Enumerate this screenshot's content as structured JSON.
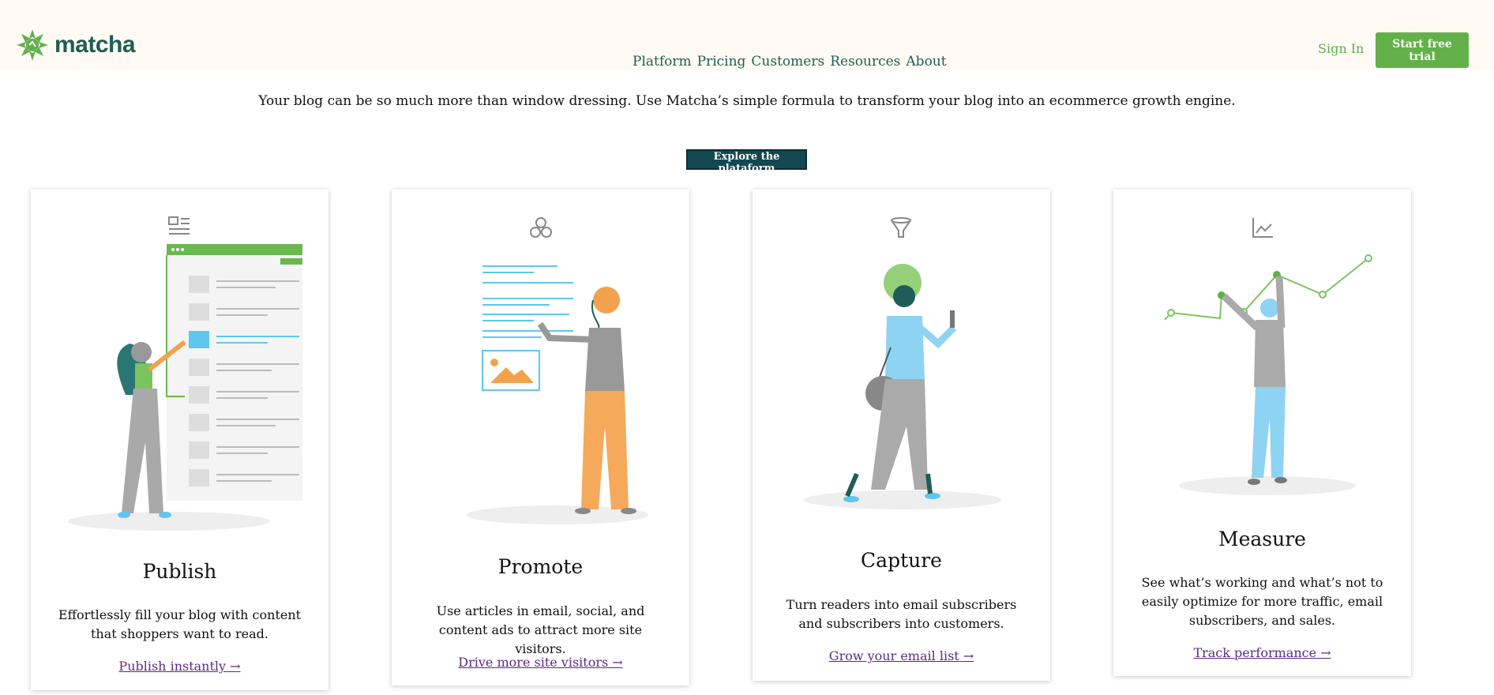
{
  "header": {
    "logo_text": "matcha",
    "nav": [
      "Platform",
      "Pricing",
      "Customers",
      "Resources",
      "About"
    ],
    "sign_in": "Sign In",
    "cta": "Start free trial"
  },
  "hero": {
    "tagline": "Your blog can be so much more than window dressing. Use Matcha’s simple formula to transform your blog into an ecommerce growth engine.",
    "button": "Explore the plataform"
  },
  "cards": [
    {
      "icon": "article-icon",
      "title": "Publish",
      "desc": "Effortlessly fill your blog with content that shoppers want to read.",
      "link": "Publish instantly →"
    },
    {
      "icon": "share-icon",
      "title": "Promote",
      "desc": "Use articles in email, social, and content ads to attract more site visitors.",
      "link": "Drive more site visitors →"
    },
    {
      "icon": "funnel-icon",
      "title": "Capture",
      "desc": "Turn readers into email subscribers and subscribers into customers.",
      "link": "Grow your email list →"
    },
    {
      "icon": "chart-icon",
      "title": "Measure",
      "desc": "See what’s working and what’s not to easily optimize for more traffic, email subscribers, and sales.",
      "link": "Track performance →"
    }
  ],
  "colors": {
    "brand_green": "#62b148",
    "brand_teal": "#1f5d56",
    "link_purple": "#5b2a86",
    "header_bg": "#fffaf4"
  }
}
